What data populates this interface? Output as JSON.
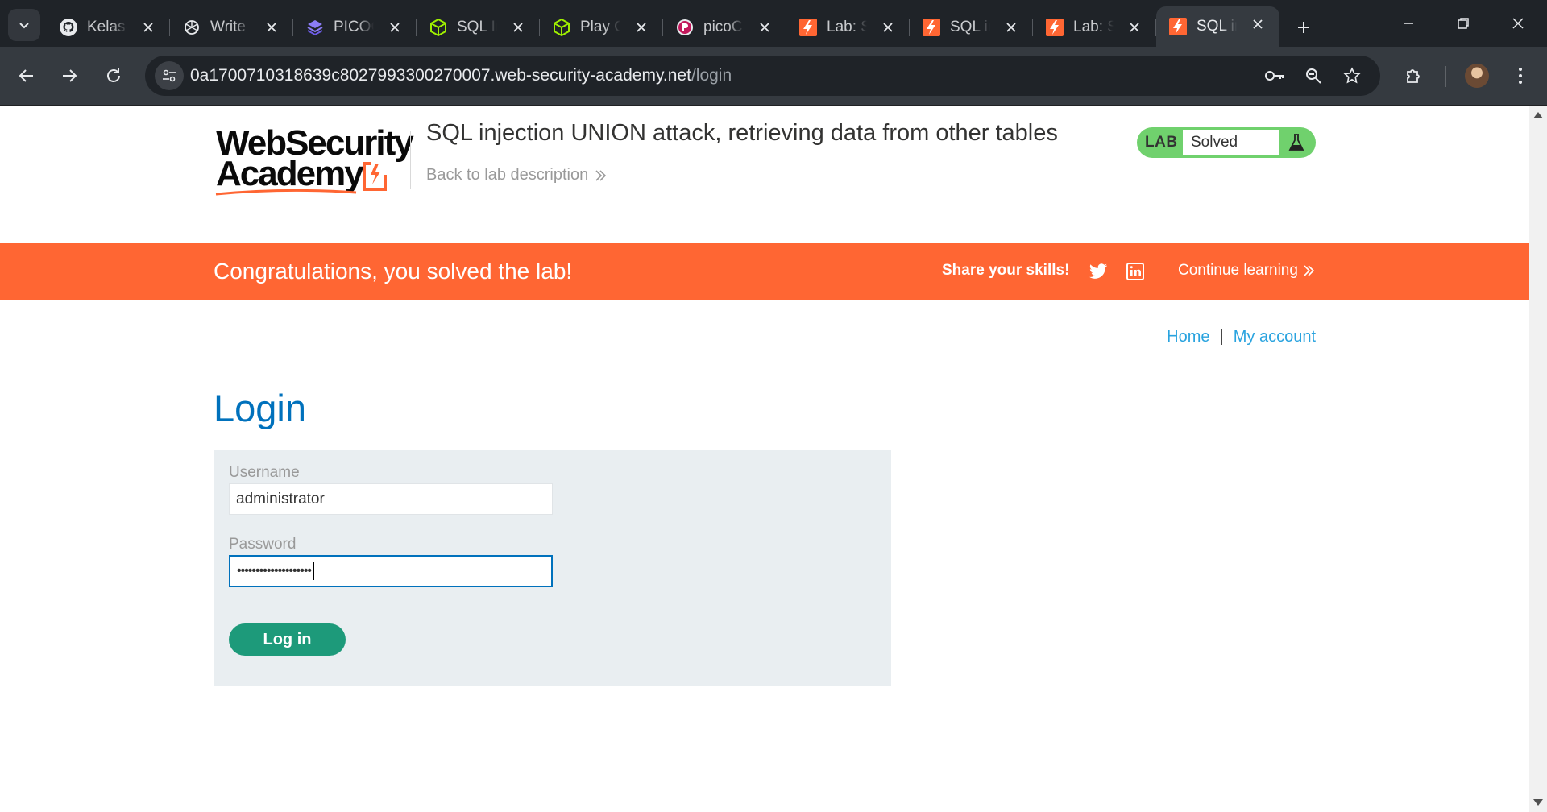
{
  "browser": {
    "tabs": [
      {
        "label": "Kelas-",
        "icon": "github-icon"
      },
      {
        "label": "Write",
        "icon": "openai-icon"
      },
      {
        "label": "PICOC",
        "icon": "layers-icon"
      },
      {
        "label": "SQL In",
        "icon": "cube-icon"
      },
      {
        "label": "Play C",
        "icon": "cube-icon"
      },
      {
        "label": "picoC",
        "icon": "picoctf-icon"
      },
      {
        "label": "Lab: S",
        "icon": "portswigger-icon"
      },
      {
        "label": "SQL in",
        "icon": "portswigger-icon"
      },
      {
        "label": "Lab: S",
        "icon": "portswigger-icon"
      },
      {
        "label": "SQL in",
        "icon": "portswigger-icon",
        "active": true
      }
    ],
    "url_host": "0a1700710318639c8027993300270007.web-security-academy.net",
    "url_path": "/login"
  },
  "header": {
    "logo_line1": "WebSecurity",
    "logo_line2": "Academy",
    "lab_title": "SQL injection UNION attack, retrieving data from other tables",
    "back_link": "Back to lab description",
    "lab_tag": "LAB",
    "lab_status": "Solved"
  },
  "banner": {
    "message": "Congratulations, you solved the lab!",
    "share": "Share your skills!",
    "continue": "Continue learning"
  },
  "nav": {
    "home": "Home",
    "separator": "|",
    "account": "My account"
  },
  "page": {
    "heading": "Login"
  },
  "form": {
    "username_label": "Username",
    "username_value": "administrator",
    "password_label": "Password",
    "password_value": "••••••••••••••••••••",
    "submit_label": "Log in"
  },
  "colors": {
    "accent_orange": "#ff6633",
    "lab_green": "#70d16d",
    "link_blue": "#29a3df",
    "heading_blue": "#0071bc",
    "button_green": "#1d9a7a"
  }
}
